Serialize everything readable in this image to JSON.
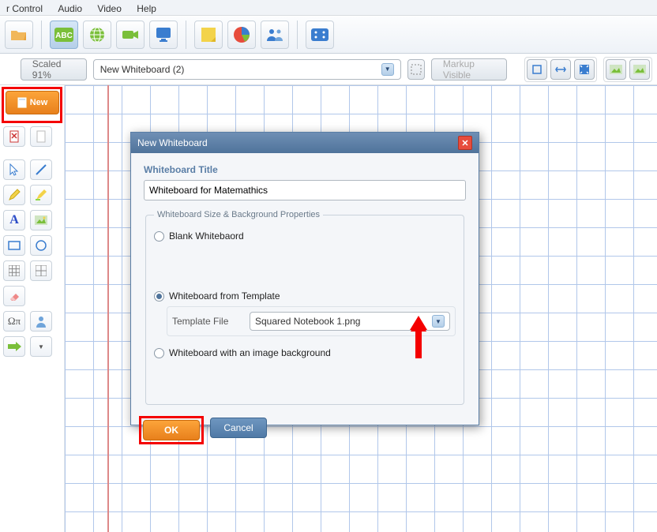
{
  "menu": {
    "items": [
      "r Control",
      "Audio",
      "Video",
      "Help"
    ]
  },
  "work": {
    "scale_label": "Scaled 91%",
    "board_name": "New Whiteboard (2)",
    "markup_label": "Markup Visible"
  },
  "newbtn": {
    "label": "New"
  },
  "dialog": {
    "title": "New Whiteboard",
    "section_title": "Whiteboard Title",
    "title_value": "Whiteboard for Matemathics",
    "legend": "Whiteboard Size & Background Properties",
    "radio_blank": "Blank Whitebaord",
    "radio_template": "Whiteboard from Template",
    "template_file_label": "Template File",
    "template_file_value": "Squared Notebook 1.png",
    "radio_image": "Whiteboard with an image background",
    "ok": "OK",
    "cancel": "Cancel"
  }
}
